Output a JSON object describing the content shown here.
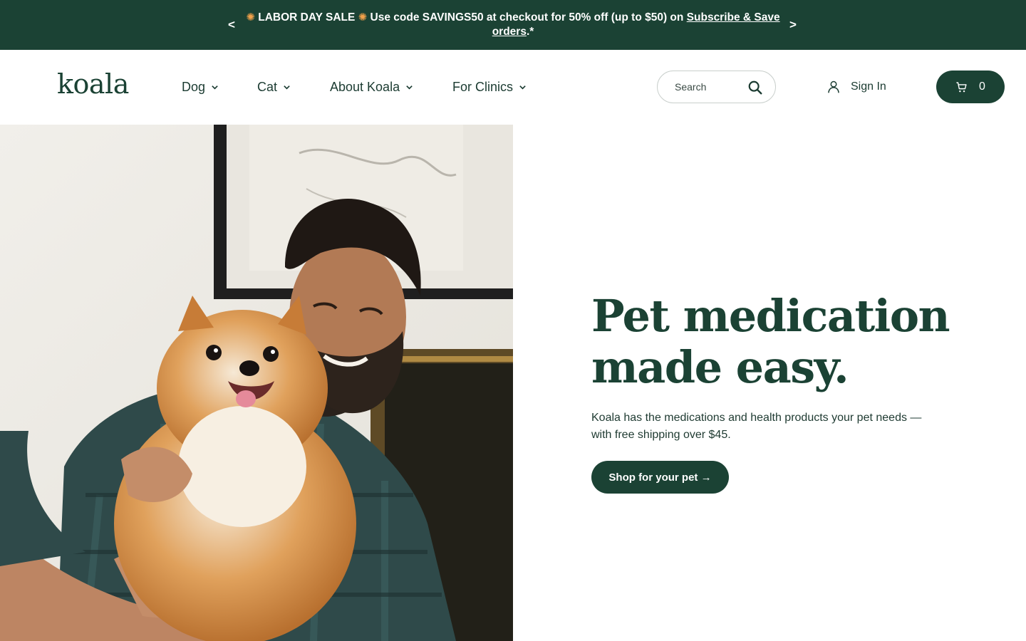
{
  "promo": {
    "prev_arrow": "<",
    "next_arrow": ">",
    "burst_glyph": "✺",
    "text_before": " LABOR DAY SALE ",
    "text_middle": " Use code SAVINGS50 at checkout for 50% off (up to $50) on ",
    "link_text": "Subscribe & Save orders",
    "text_after": ".*"
  },
  "header": {
    "logo": "koala",
    "nav": [
      {
        "label": "Dog"
      },
      {
        "label": "Cat"
      },
      {
        "label": "About Koala"
      },
      {
        "label": "For Clinics"
      }
    ],
    "search_placeholder": "Search",
    "sign_in": "Sign In",
    "cart_count": "0"
  },
  "hero": {
    "title_line1": "Pet medication",
    "title_line2": "made easy.",
    "subtitle": "Koala has the medications and health products your pet needs — with free shipping over $45.",
    "cta": "Shop for your pet →",
    "image_icon": "man-holding-pomeranian-photo"
  },
  "colors": {
    "brand_green": "#1b4234",
    "text": "#1e3a31",
    "white": "#ffffff"
  }
}
